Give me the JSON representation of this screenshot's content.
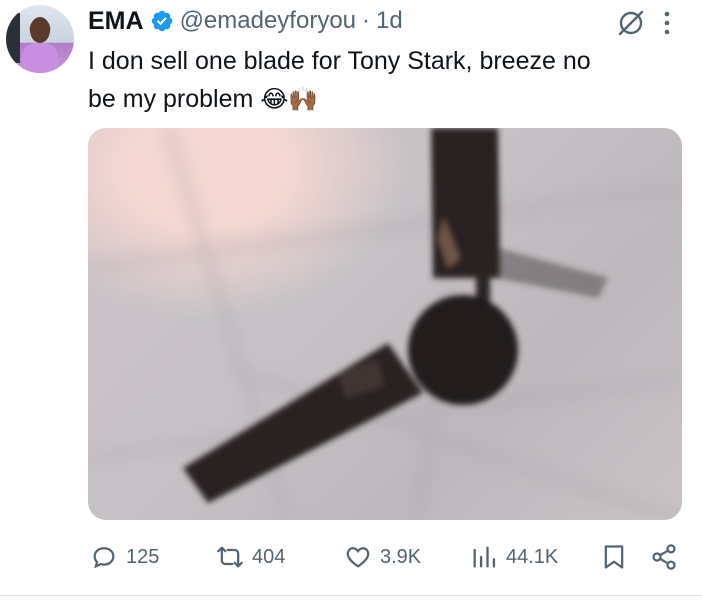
{
  "tweet": {
    "author_name": "EMA",
    "handle": "@emadeyforyou",
    "separator": "·",
    "time": "1d",
    "text_line1": "I don sell one blade for Tony Stark, breeze no",
    "text_line2": "be my problem",
    "emojis": "😂🙌🏾",
    "verified_icon": "verified-badge-icon",
    "media_description_icon": "photo"
  },
  "actions": {
    "replies": "125",
    "reposts": "404",
    "likes": "3.9K",
    "views": "44.1K"
  },
  "colors": {
    "verified": "#1d9bf0",
    "muted_text": "#536471",
    "text": "#0f1419"
  }
}
